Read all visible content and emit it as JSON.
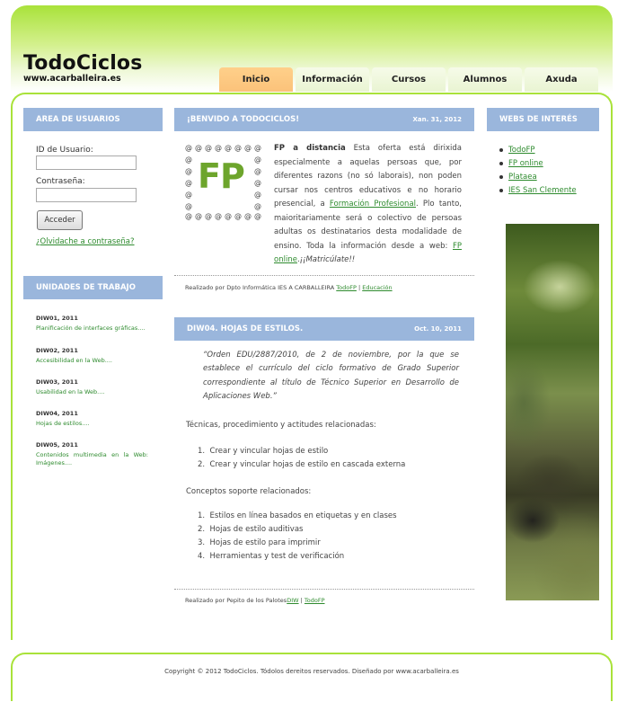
{
  "site": {
    "title": "TodoCiclos",
    "url": "www.acarballeira.es"
  },
  "nav": {
    "tabs": [
      "Inicio",
      "Información",
      "Cursos",
      "Alumnos",
      "Axuda"
    ],
    "active": "Inicio"
  },
  "left": {
    "users_heading": "AREA DE USUARIOS",
    "user_id_label": "ID de Usuario:",
    "password_label": "Contraseña:",
    "login_button": "Acceder",
    "forgot_link": "¿Olvidache a contraseña?",
    "units_heading": "UNIDADES DE TRABAJO",
    "units": [
      {
        "code": "DIW01, 2011",
        "title": "Planificación de interfaces gráficas...."
      },
      {
        "code": "DIW02, 2011",
        "title": "Accesibilidad en la Web...."
      },
      {
        "code": "DIW03, 2011",
        "title": "Usabilidad en la Web...."
      },
      {
        "code": "DIW04, 2011",
        "title": "Hojas de estilos...."
      },
      {
        "code": "DIW05, 2011",
        "title": "Contenidos multimedia en la Web: Imágenes...."
      }
    ]
  },
  "post1": {
    "heading": "¡BENVIDO A TODOCICLOS!",
    "date": "Xan. 31, 2012",
    "logo_text": "FP",
    "intro_bold": "FP a distancia",
    "text_a": " Esta oferta está dirixida especialmente a aquelas persoas que, por diferentes razons (no só laborais), non poden cursar nos centros educativos e no horario presencial, a ",
    "link_fp": "Formación Profesional",
    "text_b": ". Plo tanto, maioritariamente será o colectivo de persoas adultas os destinatarios desta modalidade de ensino. Toda la información desde a web: ",
    "link_online": "FP online",
    "text_c": ".",
    "text_italic": "¡¡Matricúlate!!",
    "meta_prefix": "Realizado por Dpto Informática IES A CARBALLEIRA ",
    "meta_link1": "TodoFP",
    "meta_sep": " | ",
    "meta_link2": "Educación"
  },
  "post2": {
    "heading": "DIW04. HOJAS DE ESTILOS.",
    "date": "Oct. 10, 2011",
    "quote": "“Orden EDU/2887/2010, de 2 de noviembre, por la que se establece el currículo del ciclo formativo de Grado Superior correspondiente al título de Técnico Superior en Desarrollo de Aplicaciones Web.”",
    "section1": "Técnicas, procedimiento y actitudes relacionadas:",
    "list1": [
      "Crear y vincular hojas de estilo",
      "Crear y vincular hojas de estilo en cascada externa"
    ],
    "section2": "Conceptos soporte relacionados:",
    "list2": [
      "Estilos en línea basados en etiquetas y en clases",
      "Hojas de estilo auditivas",
      "Hojas de estilo para imprimir",
      "Herramientas y test de verificación"
    ],
    "meta_prefix": "Realizado por Pepito de los Palotes",
    "meta_link1": "DIW",
    "meta_sep": " | ",
    "meta_link2": "TodoFP"
  },
  "right": {
    "heading": "WEBS DE INTERÉS",
    "links": [
      "TodoFP",
      "FP online",
      "Plataea",
      "IES San Clemente"
    ]
  },
  "footer": {
    "text": "Copyright © 2012 TodoCiclos. Tódolos dereitos reservados. Diseñado por www.acarballeira.es"
  },
  "colors": {
    "accent_green": "#a9e23a",
    "panel_blue": "#9ab6dc",
    "active_tab": "#fbc27a",
    "link_green": "#2e8b2e"
  }
}
